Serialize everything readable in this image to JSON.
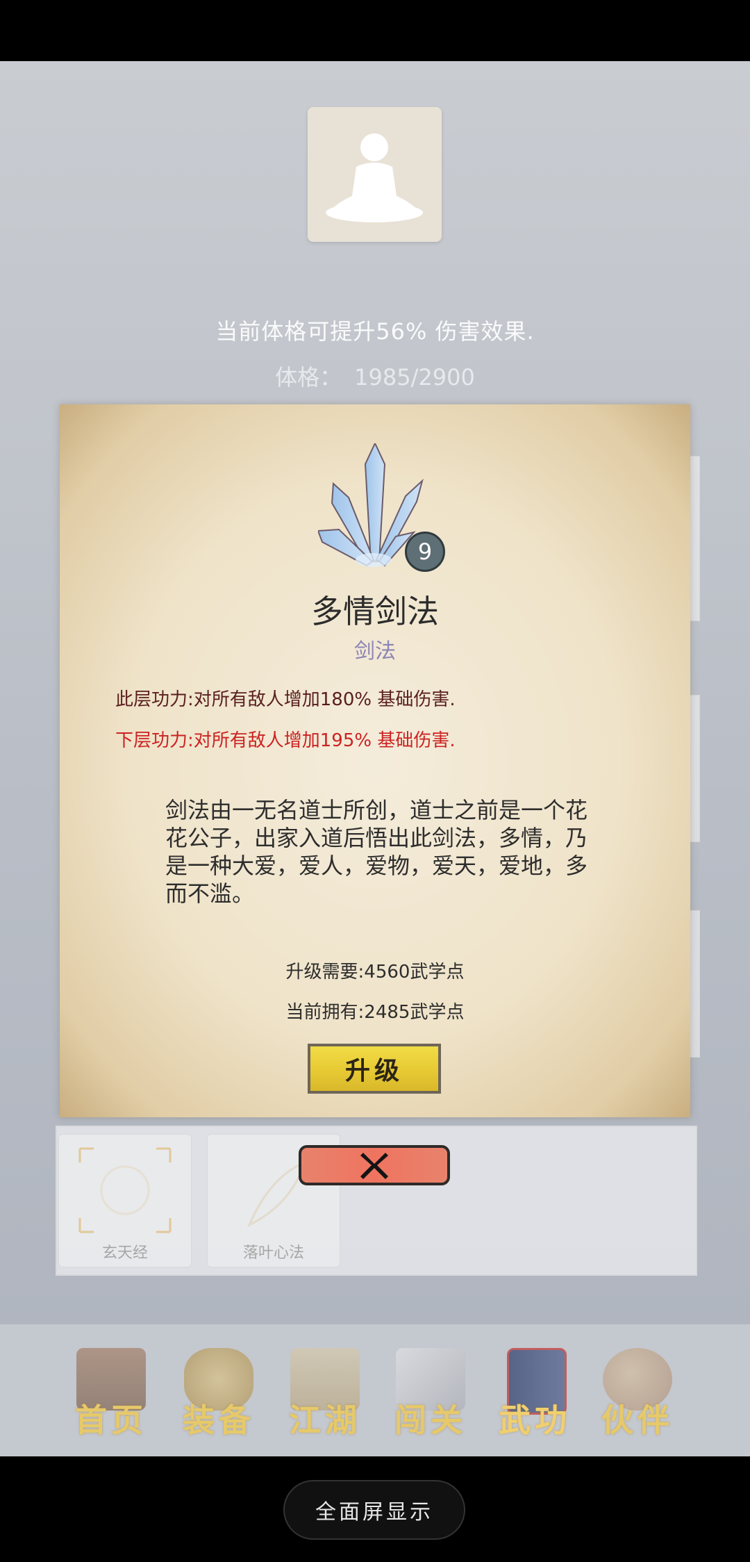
{
  "constitution": {
    "description": "当前体格可提升56% 伤害效果.",
    "label": "体格：",
    "value": "1985/2900"
  },
  "skill_dialog": {
    "level": "9",
    "name": "多情剑法",
    "type": "剑法",
    "current_effect": "此层功力:对所有敌人增加180% 基础伤害.",
    "next_effect": "下层功力:对所有敌人增加195% 基础伤害.",
    "lore": "剑法由一无名道士所创，道士之前是一个花花公子，出家入道后悟出此剑法，多情，乃是一种大爱，爱人，爱物，爱天，爱地，多而不滥。",
    "upgrade_cost": "升级需要:4560武学点",
    "current_points": "当前拥有:2485武学点",
    "upgrade_label": "升级"
  },
  "skill_list": [
    {
      "label": "玄天经"
    },
    {
      "label": "落叶心法"
    }
  ],
  "bottom_nav": {
    "items": [
      {
        "label": "首页",
        "icon": "temple-icon"
      },
      {
        "label": "装备",
        "icon": "armor-icon"
      },
      {
        "label": "江湖",
        "icon": "scroll-map-icon"
      },
      {
        "label": "闯关",
        "icon": "crossed-swords-icon"
      },
      {
        "label": "武功",
        "icon": "book-icon",
        "active": true
      },
      {
        "label": "伙伴",
        "icon": "companions-icon"
      }
    ]
  },
  "system": {
    "fullscreen_label": "全面屏显示"
  },
  "colors": {
    "effect_current": "#5a1e1e",
    "effect_next": "#cc2222",
    "skill_type": "#8c84b4",
    "upgrade_button": "#e8cb35",
    "close_button": "#ef7460",
    "nav_label": "#e6c96a"
  }
}
